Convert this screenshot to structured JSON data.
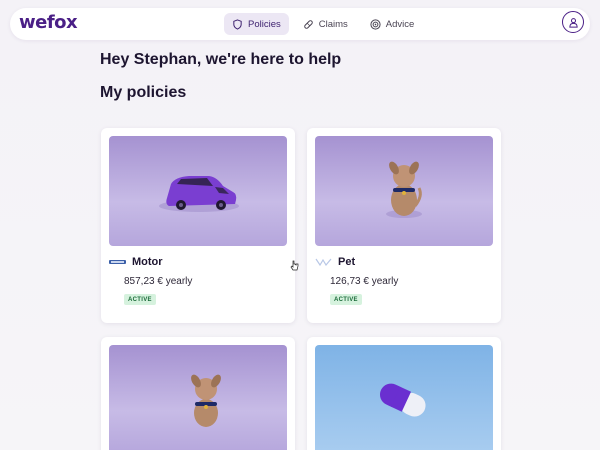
{
  "header": {
    "logo": "wefox",
    "tabs": [
      {
        "label": "Policies",
        "icon": "shield-icon",
        "active": true
      },
      {
        "label": "Claims",
        "icon": "bandage-icon",
        "active": false
      },
      {
        "label": "Advice",
        "icon": "target-icon",
        "active": false
      }
    ],
    "account_icon": "user-icon"
  },
  "main": {
    "greeting": "Hey Stephan, we're here to help",
    "section_title": "My policies",
    "policies": [
      {
        "name": "Motor",
        "price": "857,23 € yearly",
        "status": "ACTIVE",
        "image": "purple-car",
        "brand": "car-brand-logo"
      },
      {
        "name": "Pet",
        "price": "126,73 € yearly",
        "status": "ACTIVE",
        "image": "toy-dog",
        "brand": "pet-brand-logo"
      },
      {
        "image": "toy-dog"
      },
      {
        "image": "pill-capsule"
      }
    ]
  },
  "colors": {
    "brand": "#4a1f86",
    "active_tab_bg": "#ece7f4",
    "badge_bg": "#d6f2de",
    "badge_text": "#1b6b39",
    "background": "#f4f2f7"
  }
}
